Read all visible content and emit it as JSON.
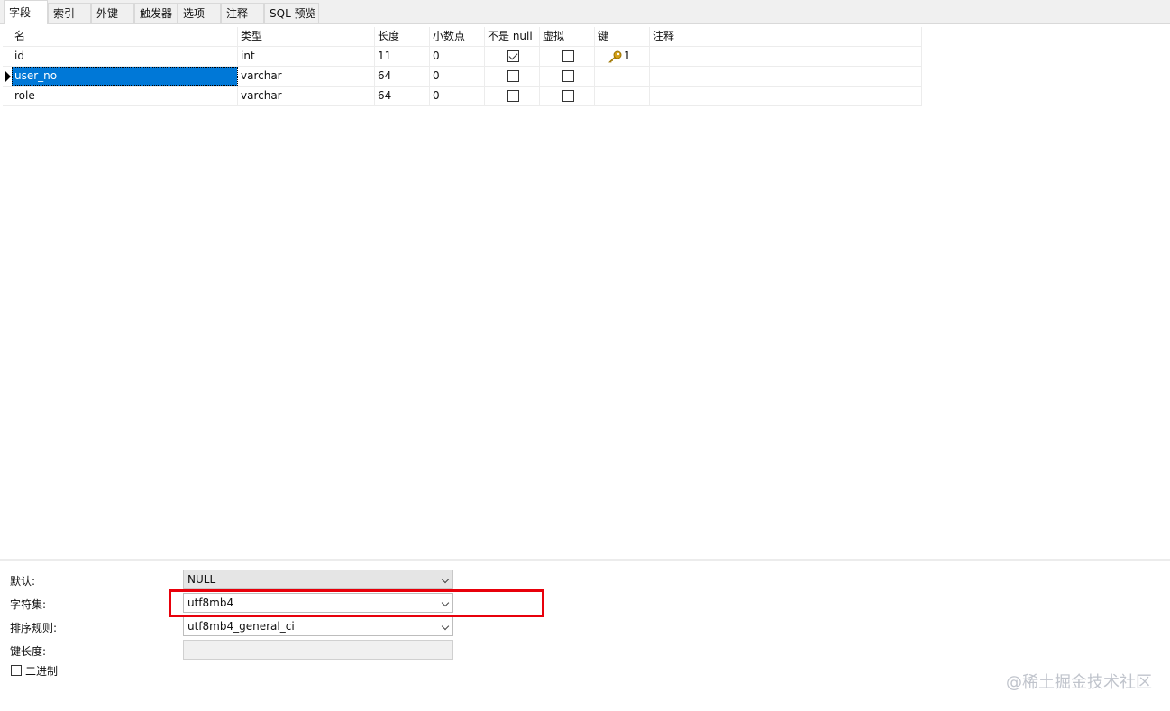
{
  "tabs": [
    {
      "label": "字段",
      "active": true
    },
    {
      "label": "索引"
    },
    {
      "label": "外键"
    },
    {
      "label": "触发器"
    },
    {
      "label": "选项"
    },
    {
      "label": "注释"
    },
    {
      "label": "SQL 预览"
    }
  ],
  "columns": [
    "名",
    "类型",
    "长度",
    "小数点",
    "不是 null",
    "虚拟",
    "键",
    "注释"
  ],
  "rows": [
    {
      "name": "id",
      "type": "int",
      "length": "11",
      "decimals": "0",
      "not_null": true,
      "virtual": false,
      "key": "1",
      "comment": ""
    },
    {
      "name": "user_no",
      "type": "varchar",
      "length": "64",
      "decimals": "0",
      "not_null": false,
      "virtual": false,
      "key": "",
      "comment": "",
      "selected": true
    },
    {
      "name": "role",
      "type": "varchar",
      "length": "64",
      "decimals": "0",
      "not_null": false,
      "virtual": false,
      "key": "",
      "comment": ""
    }
  ],
  "key_icon": "key-icon",
  "props": {
    "default_label": "默认:",
    "default_value": "NULL",
    "charset_label": "字符集:",
    "charset_value": "utf8mb4",
    "collation_label": "排序规则:",
    "collation_value": "utf8mb4_general_ci",
    "key_length_label": "键长度:",
    "key_length_value": "",
    "binary_label": "二进制",
    "binary_checked": false
  },
  "watermark": "@稀土掘金技术社区",
  "colors": {
    "selection": "#0078d7",
    "highlight_box": "#e8000b",
    "key": "#d4a017"
  }
}
